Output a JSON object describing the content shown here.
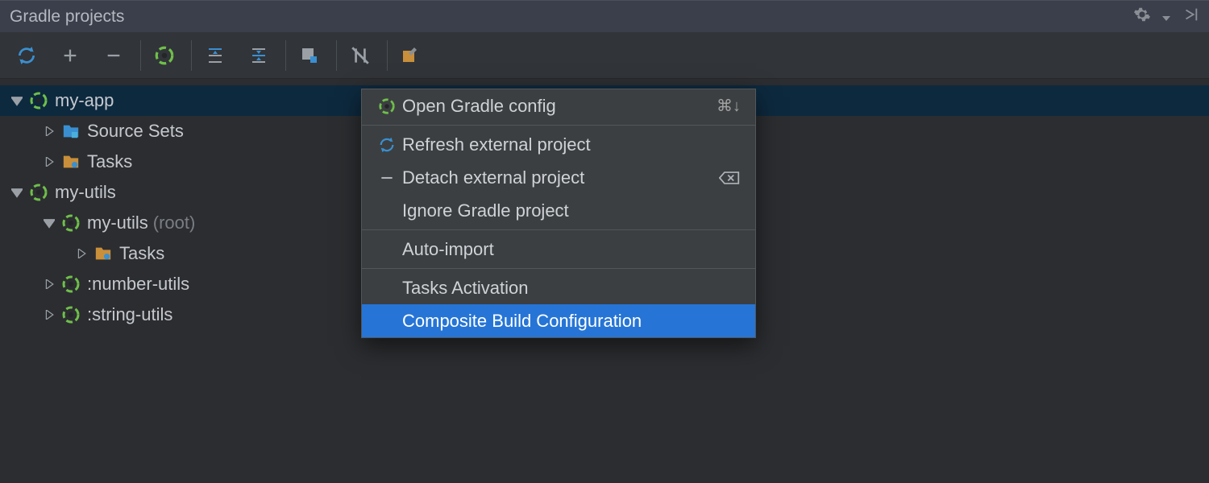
{
  "panel": {
    "title": "Gradle projects"
  },
  "toolbar": {
    "refresh": "refresh",
    "attach": "attach",
    "detach": "detach",
    "build": "build",
    "expand": "expand-all",
    "collapse": "collapse-all",
    "group": "group-tasks",
    "offline": "offline-mode",
    "settings": "gradle-settings"
  },
  "tree": {
    "nodes": [
      {
        "label": "my-app",
        "suffix": ""
      },
      {
        "label": "Source Sets",
        "suffix": ""
      },
      {
        "label": "Tasks",
        "suffix": ""
      },
      {
        "label": "my-utils",
        "suffix": ""
      },
      {
        "label": "my-utils",
        "suffix": "(root)"
      },
      {
        "label": "Tasks",
        "suffix": ""
      },
      {
        "label": ":number-utils",
        "suffix": ""
      },
      {
        "label": ":string-utils",
        "suffix": ""
      }
    ]
  },
  "menu": {
    "items": [
      {
        "label": "Open Gradle config",
        "shortcut": "⌘↓"
      },
      {
        "label": "Refresh external project",
        "shortcut": ""
      },
      {
        "label": "Detach external project",
        "shortcut": ""
      },
      {
        "label": "Ignore Gradle project",
        "shortcut": ""
      },
      {
        "label": "Auto-import",
        "shortcut": ""
      },
      {
        "label": "Tasks Activation",
        "shortcut": ""
      },
      {
        "label": "Composite Build Configuration",
        "shortcut": ""
      }
    ]
  }
}
